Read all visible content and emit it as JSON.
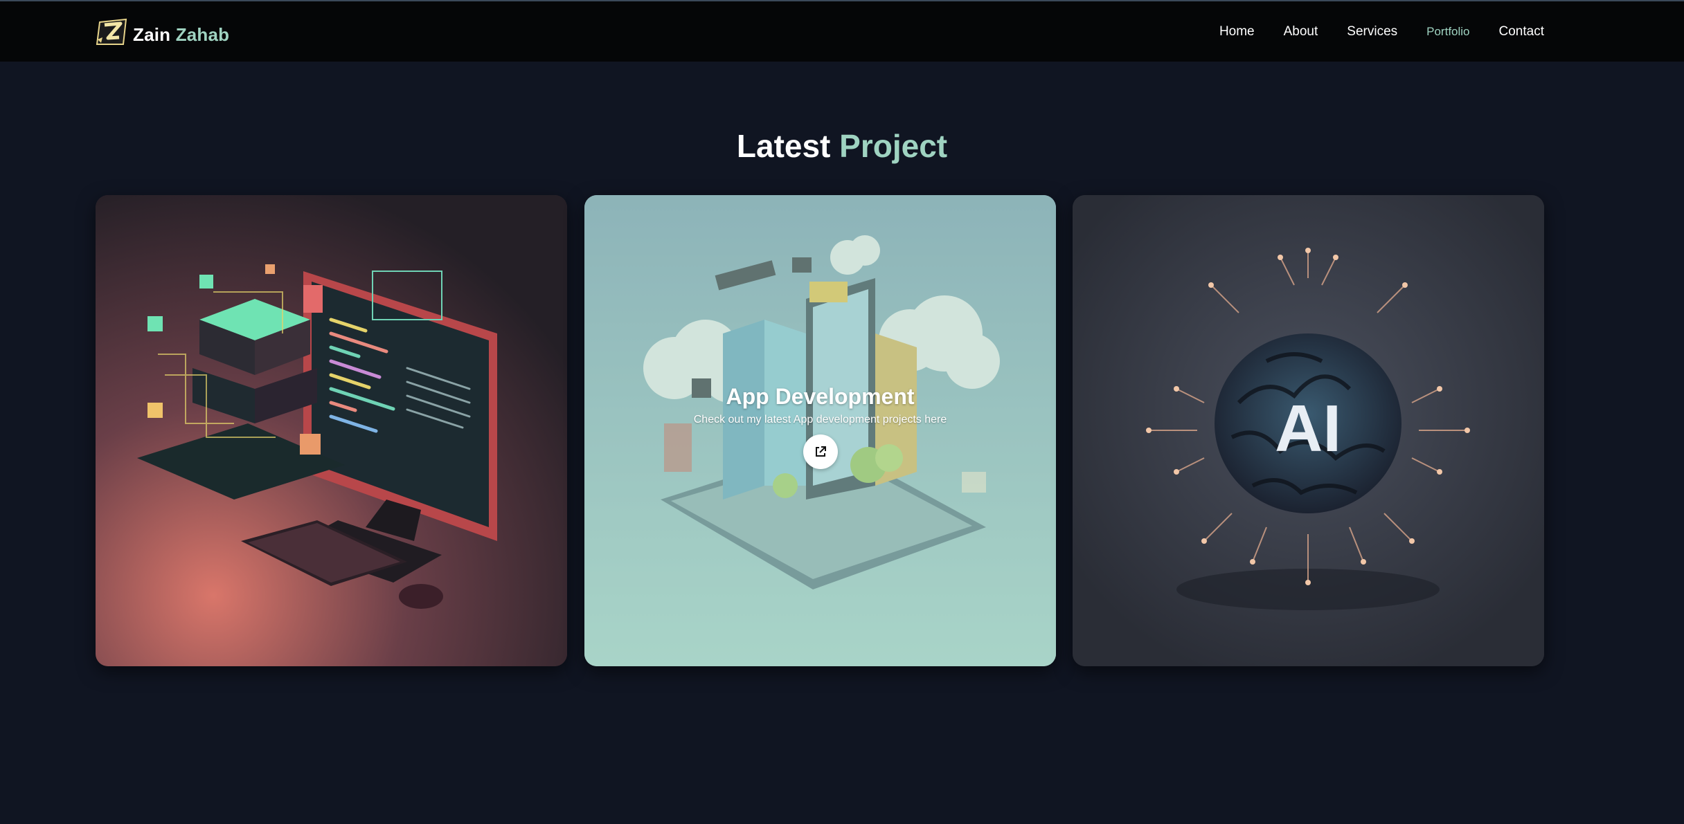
{
  "brand": {
    "first": "Zain",
    "last": "Zahab",
    "logo_icon": "z-logo-icon"
  },
  "nav": {
    "items": [
      {
        "label": "Home"
      },
      {
        "label": "About"
      },
      {
        "label": "Services"
      },
      {
        "label": "Portfolio",
        "active": true
      },
      {
        "label": "Contact"
      }
    ]
  },
  "section": {
    "title_main": "Latest",
    "title_accent": "Project"
  },
  "projects": [
    {
      "image": "web-development-isometric-computer"
    },
    {
      "image": "app-development-isometric-phone",
      "title": "App Development",
      "description": "Check out my latest App development projects here",
      "link_icon": "external-link-icon"
    },
    {
      "image": "ai-brain-artwork",
      "image_text": "AI"
    }
  ],
  "colors": {
    "background": "#101522",
    "header": "#050607",
    "accent": "#9fd3c1"
  }
}
